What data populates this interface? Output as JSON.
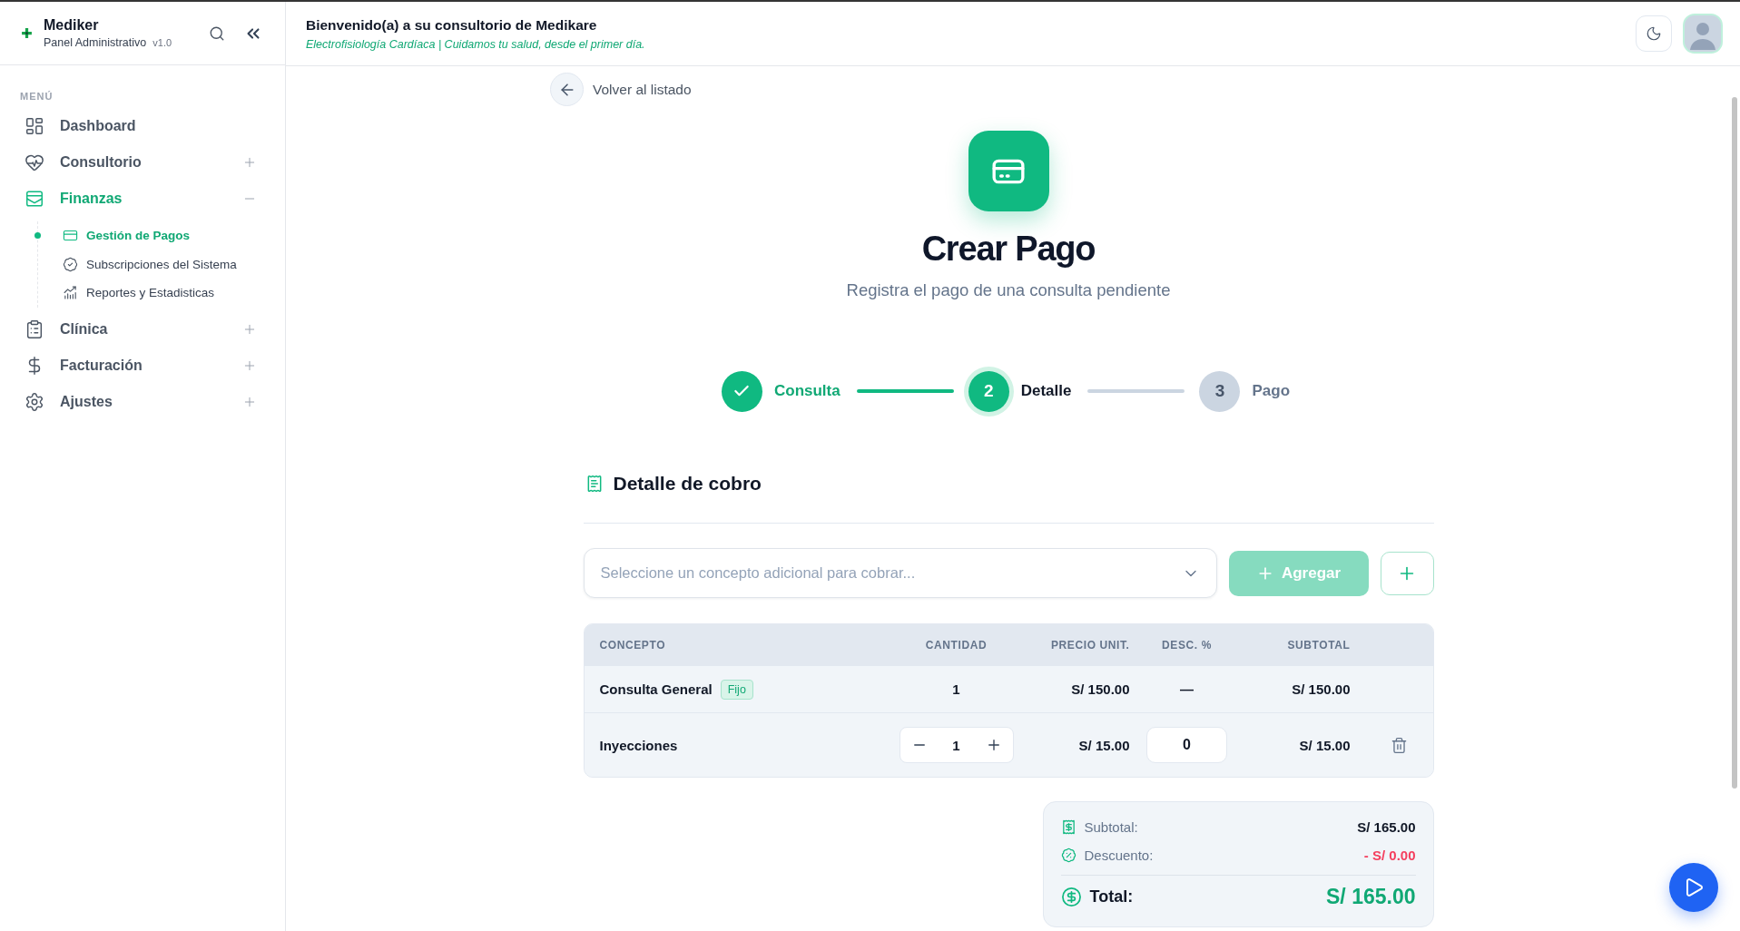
{
  "sidebar": {
    "brand": {
      "name": "Mediker",
      "subtitle": "Panel Administrativo",
      "version": "v1.0"
    },
    "menu_label": "MENÚ",
    "items": [
      {
        "label": "Dashboard",
        "kind": "link",
        "selected": false
      },
      {
        "label": "Consultorio",
        "kind": "group",
        "selected": false,
        "expanded": false
      },
      {
        "label": "Finanzas",
        "kind": "group",
        "selected": true,
        "expanded": true,
        "children": [
          {
            "label": "Gestión de Pagos",
            "selected": true
          },
          {
            "label": "Subscripciones del Sistema",
            "selected": false
          },
          {
            "label": "Reportes y Estadisticas",
            "selected": false
          }
        ]
      },
      {
        "label": "Clínica",
        "kind": "group",
        "selected": false,
        "expanded": false
      },
      {
        "label": "Facturación",
        "kind": "group",
        "selected": false,
        "expanded": false
      },
      {
        "label": "Ajustes",
        "kind": "group",
        "selected": false,
        "expanded": false
      }
    ]
  },
  "header": {
    "title": "Bienvenido(a) a su consultorio de Medikare",
    "subtitle": "Electrofisiología Cardíaca | Cuidamos tu salud, desde el primer día."
  },
  "back_link": {
    "label": "Volver al listado"
  },
  "page": {
    "title": "Crear Pago",
    "subtitle": "Registra el pago de una consulta pendiente"
  },
  "steps": [
    {
      "label": "Consulta",
      "completed": true,
      "selected": false
    },
    {
      "number": "2",
      "label": "Detalle",
      "completed": false,
      "selected": true
    },
    {
      "number": "3",
      "label": "Pago",
      "completed": false,
      "selected": false
    }
  ],
  "section": {
    "title": "Detalle de cobro"
  },
  "concept_select": {
    "placeholder": "Seleccione un concepto adicional para cobrar..."
  },
  "add_button": {
    "label": "Agregar",
    "disabled": true
  },
  "table": {
    "columns": [
      "CONCEPTO",
      "CANTIDAD",
      "PRECIO UNIT.",
      "DESC. %",
      "SUBTOTAL"
    ],
    "rows": [
      {
        "kind": "fixed",
        "concept": "Consulta General",
        "tag": "Fijo",
        "quantity": "1",
        "unit_price": "S/ 150.00",
        "discount": "—",
        "subtotal": "S/ 150.00"
      },
      {
        "kind": "editable",
        "concept": "Inyecciones",
        "quantity": "1",
        "unit_price": "S/ 15.00",
        "discount": "0",
        "subtotal": "S/ 15.00"
      }
    ]
  },
  "summary": {
    "rows": [
      {
        "kind": "subtotal",
        "label": "Subtotal:",
        "value": "S/ 165.00"
      },
      {
        "kind": "discount",
        "label": "Descuento:",
        "value": "- S/ 0.00"
      }
    ],
    "total": {
      "label": "Total:",
      "value": "S/ 165.00"
    }
  }
}
